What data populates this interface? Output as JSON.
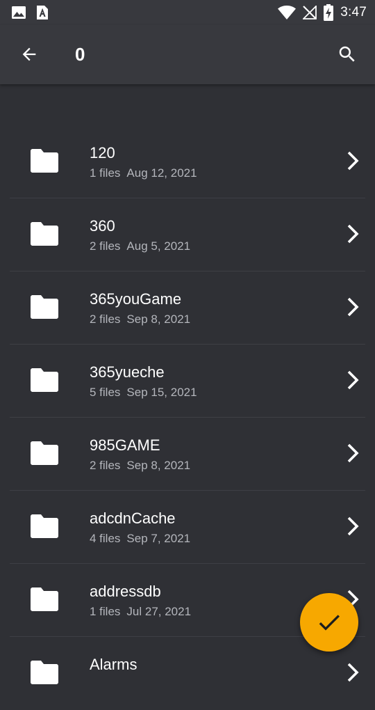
{
  "status_bar": {
    "time": "3:47",
    "left_icons": [
      "image-icon",
      "font-icon"
    ],
    "right_icons": [
      "wifi-icon",
      "no-signal-icon",
      "battery-charging-icon"
    ]
  },
  "app_bar": {
    "title": "0",
    "back_icon": "arrow-left-icon",
    "search_icon": "search-icon"
  },
  "folders": [
    {
      "name": "120",
      "count": "1 files",
      "date": "Aug 12, 2021"
    },
    {
      "name": "360",
      "count": "2 files",
      "date": "Aug 5, 2021"
    },
    {
      "name": "365youGame",
      "count": "2 files",
      "date": "Sep 8, 2021"
    },
    {
      "name": "365yueche",
      "count": "5 files",
      "date": "Sep 15, 2021"
    },
    {
      "name": "985GAME",
      "count": "2 files",
      "date": "Sep 8, 2021"
    },
    {
      "name": "adcdnCache",
      "count": "4 files",
      "date": "Sep 7, 2021"
    },
    {
      "name": "addressdb",
      "count": "1 files",
      "date": "Jul 27, 2021"
    },
    {
      "name": "Alarms",
      "count": "",
      "date": ""
    }
  ],
  "fab": {
    "icon": "check-icon",
    "color": "#f7a800"
  },
  "colors": {
    "background": "#2f3035",
    "bar": "#38393e",
    "accent": "#f7a800",
    "secondary_text": "#b4b6bc"
  }
}
